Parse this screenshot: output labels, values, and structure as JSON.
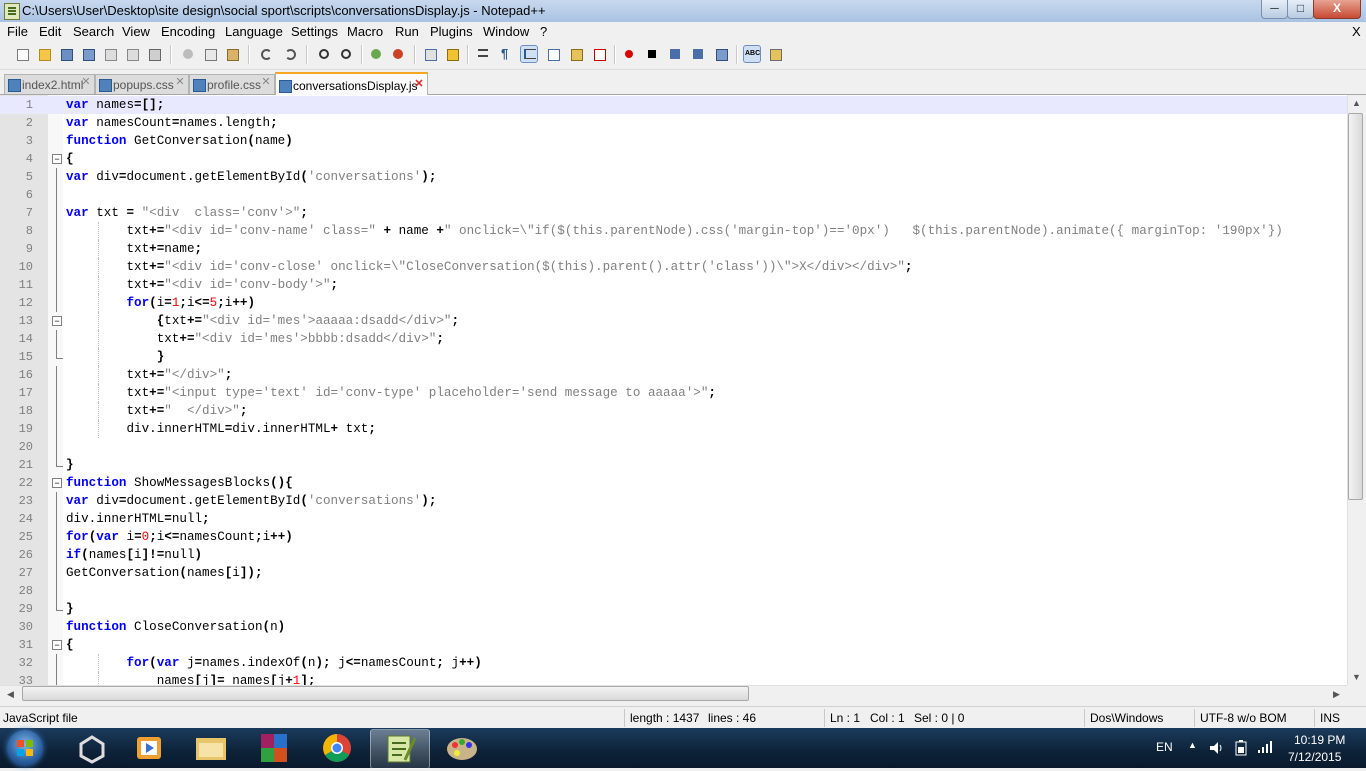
{
  "window": {
    "title": "C:\\Users\\User\\Desktop\\site design\\social sport\\scripts\\conversationsDisplay.js - Notepad++",
    "minimize": "─",
    "maximize": "□",
    "close": "X"
  },
  "menu": {
    "items": [
      "File",
      "Edit",
      "Search",
      "View",
      "Encoding",
      "Language",
      "Settings",
      "Macro",
      "Run",
      "Plugins",
      "Window",
      "?"
    ],
    "close_doc": "X"
  },
  "toolbar": {
    "icons": [
      "new-file-icon",
      "open-file-icon",
      "save-icon",
      "save-all-icon",
      "close-icon",
      "close-all-icon",
      "print-icon",
      "cut-icon",
      "copy-icon",
      "paste-icon",
      "undo-icon",
      "redo-icon",
      "find-icon",
      "replace-icon",
      "zoom-in-icon",
      "zoom-out-icon",
      "sync-vertical-icon",
      "sync-horizontal-icon",
      "word-wrap-icon",
      "show-all-chars-icon",
      "indent-guide-icon",
      "udl-icon",
      "doc-map-icon",
      "function-list-icon",
      "record-macro-icon",
      "stop-record-icon",
      "play-macro-icon",
      "run-macro-multiple-icon",
      "save-macro-icon",
      "spell-check-icon",
      "plugin-icon"
    ]
  },
  "tabs": [
    {
      "label": "index2.html",
      "active": false
    },
    {
      "label": "popups.css",
      "active": false
    },
    {
      "label": "profile.css",
      "active": false
    },
    {
      "label": "conversationsDisplay.js",
      "active": true
    }
  ],
  "editor": {
    "lines": [
      {
        "n": "1",
        "text": "var names=[];",
        "fold": "",
        "indent": 0
      },
      {
        "n": "2",
        "text": "var namesCount=names.length;",
        "fold": "",
        "indent": 0
      },
      {
        "n": "3",
        "text": "function GetConversation(name)",
        "fold": "",
        "indent": 0
      },
      {
        "n": "4",
        "text": "{",
        "fold": "open",
        "indent": 0
      },
      {
        "n": "5",
        "text": "var div=document.getElementById('conversations');",
        "fold": "line",
        "indent": 0
      },
      {
        "n": "6",
        "text": "",
        "fold": "line",
        "indent": 0
      },
      {
        "n": "7",
        "text": "var txt = \"<div  class='conv'>\";",
        "fold": "line",
        "indent": 0
      },
      {
        "n": "8",
        "text": "        txt+=\"<div id='conv-name' class=\" + name +\" onclick=\\\"if($(this.parentNode).css('margin-top')=='0px')   $(this.parentNode).animate({ marginTop: '190px'})",
        "fold": "line",
        "indent": 0
      },
      {
        "n": "9",
        "text": "        txt+=name;",
        "fold": "line",
        "indent": 0
      },
      {
        "n": "10",
        "text": "        txt+=\"<div id='conv-close' onclick=\\\"CloseConversation($(this).parent().attr('class'))\\\">X</div></div>\";",
        "fold": "line",
        "indent": 0
      },
      {
        "n": "11",
        "text": "        txt+=\"<div id='conv-body'>\";",
        "fold": "line",
        "indent": 0
      },
      {
        "n": "12",
        "text": "        for(i=1;i<=5;i++)",
        "fold": "line",
        "indent": 0
      },
      {
        "n": "13",
        "text": "            {txt+=\"<div id='mes'>aaaaa:dsadd</div>\";",
        "fold": "open",
        "indent": 1
      },
      {
        "n": "14",
        "text": "            txt+=\"<div id='mes'>bbbb:dsadd</div>\";",
        "fold": "line",
        "indent": 1
      },
      {
        "n": "15",
        "text": "            }",
        "fold": "end",
        "indent": 1
      },
      {
        "n": "16",
        "text": "        txt+=\"</div>\";",
        "fold": "line",
        "indent": 0
      },
      {
        "n": "17",
        "text": "        txt+=\"<input type='text' id='conv-type' placeholder='send message to aaaaa'>\";",
        "fold": "line",
        "indent": 0
      },
      {
        "n": "18",
        "text": "        txt+=\"  </div>\";",
        "fold": "line",
        "indent": 0
      },
      {
        "n": "19",
        "text": "        div.innerHTML=div.innerHTML+ txt;",
        "fold": "line",
        "indent": 0
      },
      {
        "n": "20",
        "text": "",
        "fold": "line",
        "indent": 0
      },
      {
        "n": "21",
        "text": "}",
        "fold": "end",
        "indent": 0
      },
      {
        "n": "22",
        "text": "function ShowMessagesBlocks(){",
        "fold": "open",
        "indent": 0
      },
      {
        "n": "23",
        "text": "var div=document.getElementById('conversations');",
        "fold": "line",
        "indent": 0
      },
      {
        "n": "24",
        "text": "div.innerHTML=null;",
        "fold": "line",
        "indent": 0
      },
      {
        "n": "25",
        "text": "for(var i=0;i<=namesCount;i++)",
        "fold": "line",
        "indent": 0
      },
      {
        "n": "26",
        "text": "if(names[i]!=null)",
        "fold": "line",
        "indent": 0
      },
      {
        "n": "27",
        "text": "GetConversation(names[i]);",
        "fold": "line",
        "indent": 0
      },
      {
        "n": "28",
        "text": "",
        "fold": "line",
        "indent": 0
      },
      {
        "n": "29",
        "text": "}",
        "fold": "end",
        "indent": 0
      },
      {
        "n": "30",
        "text": "function CloseConversation(n)",
        "fold": "",
        "indent": 0
      },
      {
        "n": "31",
        "text": "{",
        "fold": "open",
        "indent": 0
      },
      {
        "n": "32",
        "text": "        for(var j=names.indexOf(n); j<=namesCount; j++)",
        "fold": "line",
        "indent": 0
      },
      {
        "n": "33",
        "text": "            names[j]= names[j+1];",
        "fold": "line",
        "indent": 1
      }
    ]
  },
  "statusbar": {
    "filetype": "JavaScript file",
    "length": "length : 1437",
    "lines": "lines : 46",
    "ln": "Ln : 1",
    "col": "Col : 1",
    "sel": "Sel : 0 | 0",
    "eol": "Dos\\Windows",
    "encoding": "UTF-8 w/o BOM",
    "mode": "INS"
  },
  "taskbar": {
    "apps": [
      "unity-icon",
      "media-player-icon",
      "file-explorer-icon",
      "winrar-icon",
      "chrome-icon",
      "notepadpp-icon",
      "paint-icon"
    ],
    "active_app": "notepadpp-icon",
    "language": "EN",
    "time": "10:19 PM",
    "date": "7/12/2015"
  },
  "colors": {
    "keyword": "#0000ff",
    "string": "#808080",
    "number": "#ff0000",
    "current_line": "#e8e8ff",
    "tab_accent": "#f5a623"
  }
}
